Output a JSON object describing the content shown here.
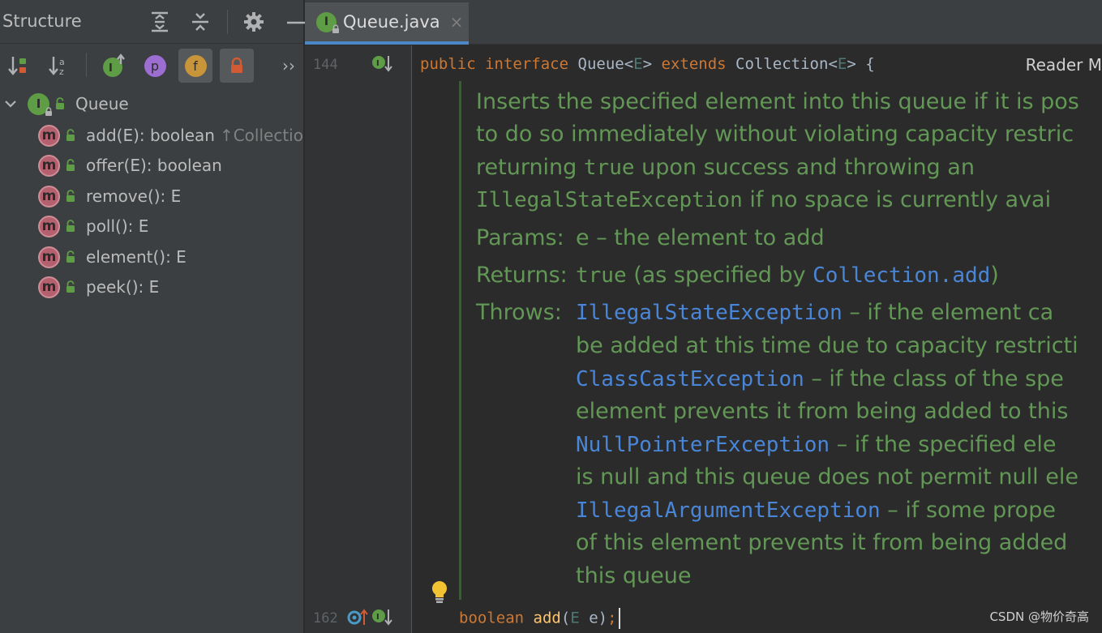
{
  "structure": {
    "title": "Structure",
    "toolbar": {
      "field_letter": "f",
      "property_letter": "p",
      "more_glyph": "››"
    },
    "root": {
      "icon_letter": "I",
      "label": "Queue"
    },
    "items": [
      {
        "label": "add(E): boolean",
        "hint": "↑Collectio"
      },
      {
        "label": "offer(E): boolean",
        "hint": ""
      },
      {
        "label": "remove(): E",
        "hint": ""
      },
      {
        "label": "poll(): E",
        "hint": ""
      },
      {
        "label": "element(): E",
        "hint": ""
      },
      {
        "label": "peek(): E",
        "hint": ""
      }
    ],
    "method_icon_letter": "m"
  },
  "editor": {
    "tab": {
      "icon_letter": "I",
      "name": "Queue.java",
      "close": "×"
    },
    "reader_mode": "Reader M",
    "lines": {
      "first": "144",
      "last": "162"
    },
    "code_top": {
      "kw_public": "public",
      "kw_interface": "interface",
      "name": "Queue",
      "lt": "<",
      "tp": "E",
      "gt": ">",
      "kw_extends": "extends",
      "parent": "Collection",
      "brace": " {"
    },
    "code_bottom": {
      "kw_boolean": "boolean",
      "method": "add",
      "paren_open": "(",
      "param_type": "E",
      "param_name": " e)",
      "semicolon": ";"
    },
    "doc": {
      "line1": "Inserts the specified element into this queue if it is pos",
      "line2": "to do so immediately without violating capacity restric",
      "line3a": "returning ",
      "line3b": "true",
      "line3c": " upon success and throwing an",
      "line4a": "IllegalStateException",
      "line4b": " if no space is currently avai",
      "params_label": "Params:",
      "params_text": "e – the element to add",
      "returns_label": "Returns:",
      "returns_mono": "true",
      "returns_text": " (as specified by ",
      "returns_link": "Collection.add",
      "returns_close": ")",
      "throws_label": "Throws:",
      "t1_link": "IllegalStateException",
      "t1_text": " – if the element ca",
      "t1_line2": "be added at this time due to capacity restricti",
      "t2_link": "ClassCastException",
      "t2_text": " – if the class of the spe",
      "t2_line2": "element prevents it from being added to this",
      "t3_link": "NullPointerException",
      "t3_text": " – if the specified ele",
      "t3_line2": "is null and this queue does not permit null ele",
      "t4_link": "IllegalArgumentException",
      "t4_text": " – if some prope",
      "t4_line2": "of this element prevents it from being added",
      "t4_line3": "this queue"
    }
  },
  "watermark": "CSDN @物价奇高",
  "colors": {
    "interface_icon": "#5e9c45",
    "method_icon": "#b4606e",
    "property_icon": "#9d6ed1",
    "field_icon": "#c9953a",
    "lock_red": "#d25b35",
    "doc_green": "#629755",
    "link_blue": "#4a86d8",
    "keyword": "#cc7832",
    "tab_underline": "#4a88c7"
  }
}
